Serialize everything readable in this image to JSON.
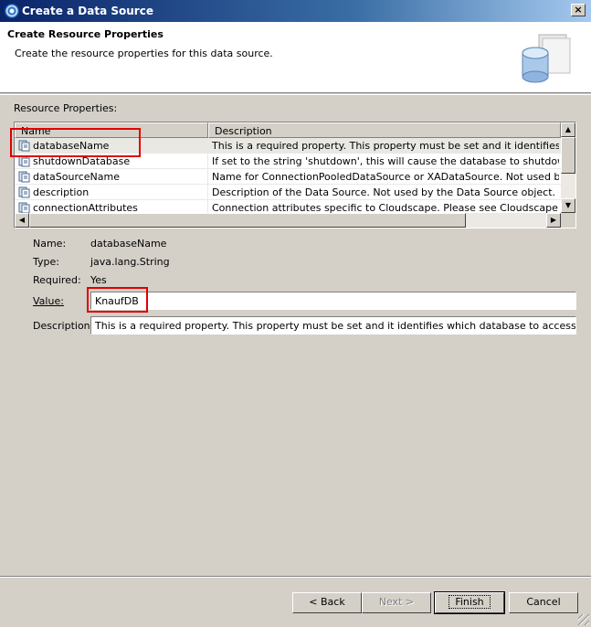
{
  "window": {
    "title": "Create a Data Source",
    "close_glyph": "×",
    "icon": "app-spiral-icon"
  },
  "header": {
    "title": "Create Resource Properties",
    "description": "Create the resource properties for this data source.",
    "icon": "database-icon"
  },
  "properties": {
    "section_label": "Resource Properties:",
    "columns": {
      "name": "Name",
      "description": "Description"
    },
    "rows": [
      {
        "name": "databaseName",
        "description": "This is a required property. This property must be set and it identifies which dat"
      },
      {
        "name": "shutdownDatabase",
        "description": "If set to the string 'shutdown', this will cause the database to shutdown when a"
      },
      {
        "name": "dataSourceName",
        "description": "Name for ConnectionPooledDataSource or XADataSource. Not used by the data"
      },
      {
        "name": "description",
        "description": "Description of the Data Source. Not used by the Data Source object. Used for in"
      },
      {
        "name": "connectionAttributes",
        "description": "Connection attributes specific to Cloudscape. Please see Cloudscape document"
      }
    ],
    "selected_index": 0
  },
  "details": {
    "name_label": "Name:",
    "name_value": "databaseName",
    "type_label": "Type:",
    "type_value": "java.lang.String",
    "required_label": "Required:",
    "required_value": "Yes",
    "value_label": "Value:",
    "value_input": "KnaufDB",
    "description_label": "Description:",
    "description_value": "This is a required property. This property must be set and it identifies which database to access. For example"
  },
  "buttons": {
    "back": "< Back",
    "next": "Next >",
    "finish": "Finish",
    "cancel": "Cancel"
  },
  "colors": {
    "titlebar_start": "#0a246a",
    "highlight_box": "#e00000",
    "dialog_bg": "#d4d0c8"
  }
}
